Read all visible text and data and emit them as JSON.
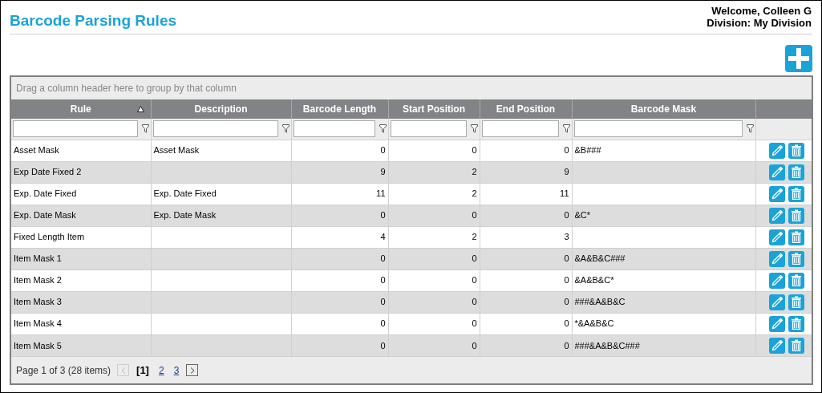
{
  "page": {
    "title": "Barcode Parsing Rules",
    "welcome": "Welcome, Colleen G",
    "division": "Division: My Division"
  },
  "grid": {
    "group_hint": "Drag a column header here to group by that column",
    "columns": [
      {
        "label": "Rule",
        "sorted": true,
        "kind": "text"
      },
      {
        "label": "Description",
        "sorted": false,
        "kind": "text"
      },
      {
        "label": "Barcode Length",
        "sorted": false,
        "kind": "number"
      },
      {
        "label": "Start Position",
        "sorted": false,
        "kind": "number"
      },
      {
        "label": "End Position",
        "sorted": false,
        "kind": "number"
      },
      {
        "label": "Barcode Mask",
        "sorted": false,
        "kind": "text"
      }
    ],
    "rows": [
      {
        "cells": [
          "Asset Mask",
          "Asset Mask",
          "0",
          "0",
          "0",
          "&B###"
        ]
      },
      {
        "cells": [
          "Exp Date Fixed 2",
          "",
          "9",
          "2",
          "9",
          ""
        ]
      },
      {
        "cells": [
          "Exp. Date Fixed",
          "Exp. Date Fixed",
          "11",
          "2",
          "11",
          ""
        ]
      },
      {
        "cells": [
          "Exp. Date Mask",
          "Exp. Date Mask",
          "0",
          "0",
          "0",
          "&C*"
        ]
      },
      {
        "cells": [
          "Fixed Length Item",
          "",
          "4",
          "2",
          "3",
          ""
        ]
      },
      {
        "cells": [
          "Item Mask 1",
          "",
          "0",
          "0",
          "0",
          "&A&B&C###"
        ]
      },
      {
        "cells": [
          "Item Mask 2",
          "",
          "0",
          "0",
          "0",
          "&A&B&C*"
        ]
      },
      {
        "cells": [
          "Item Mask 3",
          "",
          "0",
          "0",
          "0",
          "###&A&B&C"
        ]
      },
      {
        "cells": [
          "Item Mask 4",
          "",
          "0",
          "0",
          "0",
          "*&A&B&C"
        ]
      },
      {
        "cells": [
          "Item Mask 5",
          "",
          "0",
          "0",
          "0",
          "###&A&B&C###"
        ]
      }
    ],
    "pager": {
      "summary": "Page 1 of 3 (28 items)",
      "prev_disabled": true,
      "pages": [
        {
          "label": "[1]",
          "selected": true
        },
        {
          "label": "2",
          "selected": false
        },
        {
          "label": "3",
          "selected": false
        }
      ]
    }
  }
}
